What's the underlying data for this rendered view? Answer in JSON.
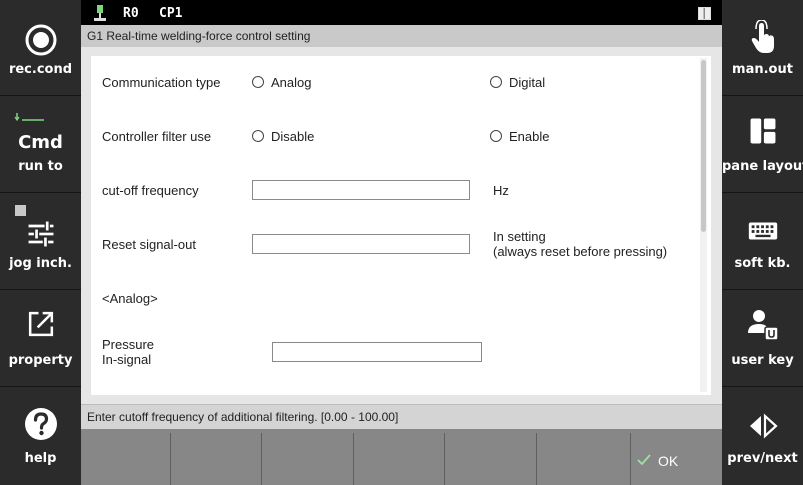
{
  "topbar": {
    "robot": "R0",
    "program": "CP1"
  },
  "window_title": "G1  Real-time welding-force control setting",
  "left_buttons": [
    {
      "label": "rec.cond",
      "icon": "record-icon"
    },
    {
      "label": "run to",
      "title": "Cmd",
      "icon": "step-icon"
    },
    {
      "label": "jog inch.",
      "icon": "sliders-icon"
    },
    {
      "label": "property",
      "icon": "external-link-icon"
    },
    {
      "label": "help",
      "icon": "question-icon"
    }
  ],
  "right_buttons": [
    {
      "label": "man.out",
      "icon": "hand-pointer-icon"
    },
    {
      "label": "pane layout",
      "icon": "layout-icon"
    },
    {
      "label": "soft kb.",
      "icon": "keyboard-icon"
    },
    {
      "label": "user key",
      "icon": "user-key-icon"
    },
    {
      "label": "prev/next",
      "icon": "prev-next-icon"
    }
  ],
  "form": {
    "communication_type": {
      "label": "Communication type",
      "options": [
        "Analog",
        "Digital"
      ]
    },
    "controller_filter": {
      "label": "Controller filter use",
      "options": [
        "Disable",
        "Enable"
      ]
    },
    "cutoff": {
      "label": "cut-off frequency",
      "value": "",
      "unit": "Hz"
    },
    "reset_signal": {
      "label": "Reset signal-out",
      "value": "",
      "note_line1": "In setting",
      "note_line2": "(always reset before pressing)"
    },
    "analog_section": "<Analog>",
    "pressure": {
      "label_line1": "Pressure",
      "label_line2": "In-signal",
      "value": ""
    }
  },
  "status_text": "Enter cutoff frequency of additional filtering. [0.00 - 100.00]",
  "bottom": {
    "ok_label": "OK"
  }
}
